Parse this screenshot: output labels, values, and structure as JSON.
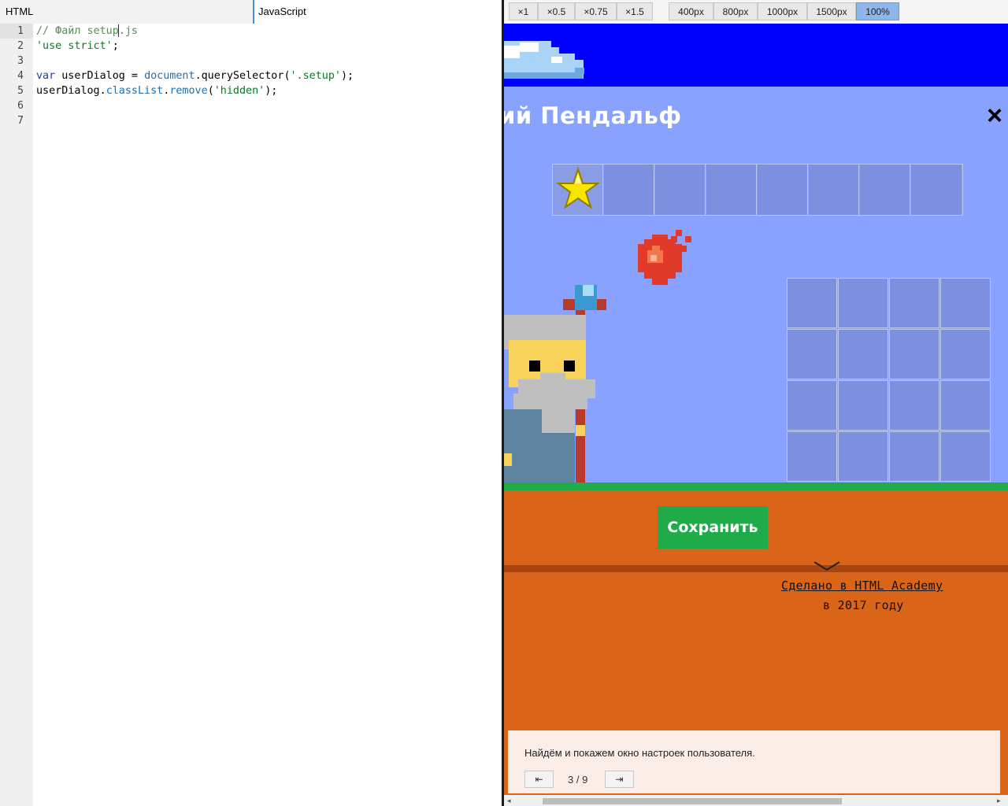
{
  "editor": {
    "tabs": [
      {
        "label": "HTML"
      },
      {
        "label": "JavaScript"
      }
    ],
    "line_numbers": [
      "1",
      "2",
      "3",
      "4",
      "5",
      "6",
      "7"
    ],
    "code": {
      "l1_comment_a": "// Файл setup",
      "l1_comment_b": ".js",
      "l2_string": "'use strict'",
      "l2_end": ";",
      "l4_kw": "var",
      "l4_ident": " userDialog = ",
      "l4_obj": "document",
      "l4_dot": ".",
      "l4_method": "querySelector",
      "l4_open": "(",
      "l4_arg": "'.setup'",
      "l4_close": ");",
      "l5_ident": "userDialog.",
      "l5_prop": "classList",
      "l5_dot": ".",
      "l5_method": "remove",
      "l5_open": "(",
      "l5_arg": "'hidden'",
      "l5_close": ");"
    }
  },
  "preview_toolbar": {
    "scale_buttons": [
      "×1",
      "×0.5",
      "×0.75",
      "×1.5"
    ],
    "width_buttons": [
      "400px",
      "800px",
      "1000px",
      "1500px",
      "100%"
    ],
    "selected": "100%"
  },
  "preview": {
    "setup_title": "ий Пендальф",
    "close_icon": "×",
    "save_button": "Сохранить",
    "footer_link": "Сделано в HTML Academy",
    "footer_year": "в 2017 году",
    "colors": {
      "sky": "#0000ff",
      "setup_bg": "#89a1ff",
      "grass": "#1fab47",
      "ground": "#da6519",
      "save": "#1fab47"
    }
  },
  "task": {
    "text": "Найдём и покажем окно настроек пользователя.",
    "prev_icon": "⇤",
    "next_icon": "⇥",
    "page": "3 / 9"
  }
}
